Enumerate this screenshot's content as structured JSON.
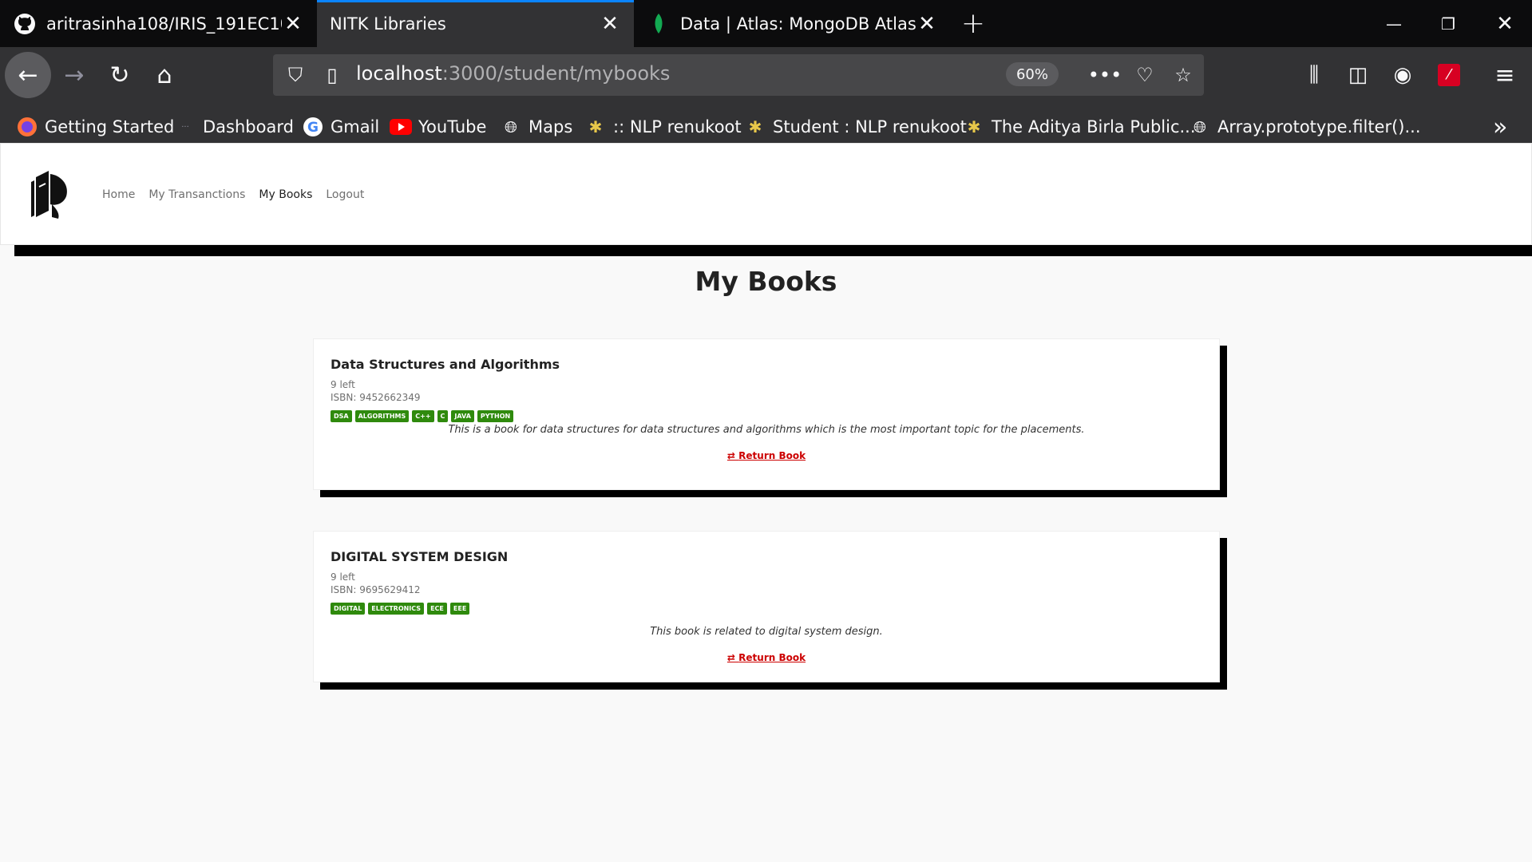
{
  "browser": {
    "tabs": [
      {
        "title": "aritrasinha108/IRIS_191EC108_I",
        "icon": "github-icon",
        "active": false
      },
      {
        "title": "NITK Libraries",
        "icon": "",
        "active": true
      },
      {
        "title": "Data | Atlas: MongoDB Atlas",
        "icon": "mongodb-leaf-icon",
        "active": false
      }
    ],
    "url": {
      "host": "localhost",
      "rest": ":3000/student/mybooks"
    },
    "zoom": "60%",
    "bookmarks": [
      {
        "label": "Getting Started",
        "icon": "firefox-icon"
      },
      {
        "label": "Dashboard",
        "icon": "dots-icon"
      },
      {
        "label": "Gmail",
        "icon": "google-icon"
      },
      {
        "label": "YouTube",
        "icon": "youtube-icon"
      },
      {
        "label": "Maps",
        "icon": "globe-icon"
      },
      {
        "label": ":: NLP renukoot",
        "icon": "school-icon"
      },
      {
        "label": "Student : NLP renukoot",
        "icon": "school-icon"
      },
      {
        "label": "The Aditya Birla Public...",
        "icon": "school-icon"
      },
      {
        "label": "Array.prototype.filter()...",
        "icon": "globe-icon"
      }
    ]
  },
  "site": {
    "nav": [
      "Home",
      "My Transanctions",
      "My Books",
      "Logout"
    ],
    "active_nav": "My Books",
    "page_title": "My Books"
  },
  "books": [
    {
      "title": "Data Structures and Algorithms",
      "left": "9 left",
      "isbn": "ISBN: 9452662349",
      "tags": [
        "DSA",
        "ALGORITHMS",
        "C++",
        "C",
        "JAVA",
        "PYTHON"
      ],
      "description": "This is a book for data structures for data structures and algorithms which is the most important topic for the placements.",
      "action": "Return Book"
    },
    {
      "title": "DIGITAL SYSTEM DESIGN",
      "left": "9 left",
      "isbn": "ISBN: 9695629412",
      "tags": [
        "DIGITAL",
        "ELECTRONICS",
        "ECE",
        "EEE"
      ],
      "description": "This book is related to digital system design.",
      "action": "Return Book"
    }
  ],
  "colors": {
    "tag_bg": "#2f8a0d",
    "return_red": "#cc0000",
    "active_tab_accent": "#0a84ff"
  }
}
